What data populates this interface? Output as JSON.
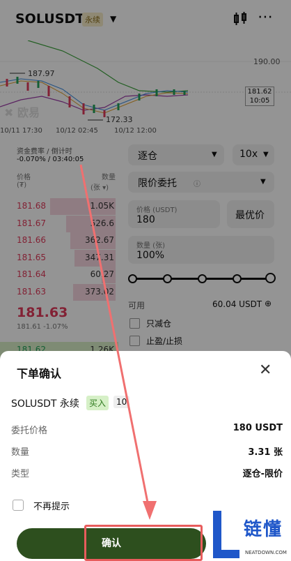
{
  "header": {
    "symbol": "SOLUSDT",
    "contract_tag": "永续"
  },
  "chart": {
    "price_marks": [
      "190.00",
      "187.97",
      "172.33"
    ],
    "current_price": "181.62",
    "countdown": "10:05",
    "times": [
      "10/11 17:30",
      "10/12 02:45",
      "10/12 12:00"
    ],
    "watermark": "欧易"
  },
  "funding": {
    "label": "资金费率 / 倒计时",
    "value": "-0.070% / 03:40:05"
  },
  "orderbook": {
    "price_header": "价格",
    "price_unit": "(₮)",
    "qty_header": "数量",
    "qty_unit": "(张 ▾)",
    "asks": [
      {
        "price": "181.68",
        "qty": "1.05K",
        "depth": 0.55
      },
      {
        "price": "181.67",
        "qty": "526.6",
        "depth": 0.42
      },
      {
        "price": "181.66",
        "qty": "362.67",
        "depth": 0.38
      },
      {
        "price": "181.65",
        "qty": "347.31",
        "depth": 0.35
      },
      {
        "price": "181.64",
        "qty": "60.27",
        "depth": 0.12
      },
      {
        "price": "181.63",
        "qty": "373.02",
        "depth": 0.36
      }
    ],
    "last_price": "181.63",
    "last_sub": "181.61 -1.07%",
    "bid_first": {
      "price": "181.62",
      "qty": "1.26K"
    }
  },
  "order_form": {
    "margin_mode": "逐仓",
    "leverage": "10x",
    "order_type": "限价委托",
    "price_label": "价格 (USDT)",
    "price_value": "180",
    "best_price": "最优价",
    "qty_label": "数量 (张)",
    "qty_value": "100%",
    "slider_percent": 100,
    "avail_label": "可用",
    "avail_value": "60.04 USDT",
    "reduce_only": "只减仓",
    "tp_sl": "止盈/止损"
  },
  "sheet": {
    "title": "下单确认",
    "pair": "SOLUSDT 永续",
    "side": "买入",
    "leverage": "10",
    "rows": [
      {
        "label": "委托价格",
        "value": "180 USDT"
      },
      {
        "label": "数量",
        "value": "3.31 张"
      },
      {
        "label": "类型",
        "value": "逐仓-限价"
      }
    ],
    "no_remind": "不再提示",
    "confirm": "确认"
  },
  "watermark": {
    "title": "链懂",
    "site": "NEATDOWN.COM"
  },
  "colors": {
    "ask": "#e03a5a",
    "confirm_bg": "#2d4f1e",
    "buy_tag": "#d6f0c7",
    "highlight": "#e85c5c",
    "brand": "#1f57c9"
  }
}
